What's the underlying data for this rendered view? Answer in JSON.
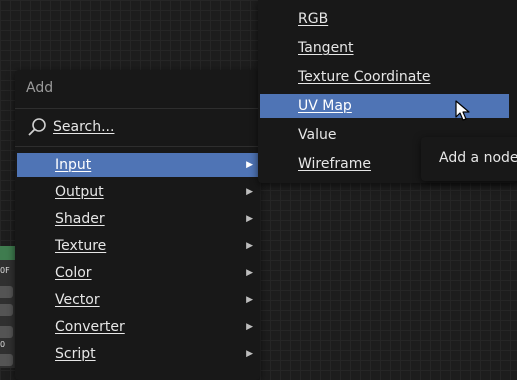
{
  "background_node": {
    "field_a": "0F",
    "field_b": "0"
  },
  "add_menu": {
    "title": "Add",
    "search": {
      "label": "Search..."
    },
    "items": [
      {
        "label": "Input",
        "active": true
      },
      {
        "label": "Output"
      },
      {
        "label": "Shader"
      },
      {
        "label": "Texture"
      },
      {
        "label": "Color"
      },
      {
        "label": "Vector"
      },
      {
        "label": "Converter"
      },
      {
        "label": "Script"
      }
    ]
  },
  "input_submenu": {
    "items": [
      {
        "label": "RGB"
      },
      {
        "label": "Tangent"
      },
      {
        "label": "Texture Coordinate"
      },
      {
        "label": "UV Map",
        "active": true
      },
      {
        "label": "Value"
      },
      {
        "label": "Wireframe"
      }
    ]
  },
  "tooltip": {
    "text": "Add a node"
  },
  "colors": {
    "highlight": "#4f74b5",
    "menu_bg": "#181818",
    "node_header": "#3f7c4f"
  }
}
